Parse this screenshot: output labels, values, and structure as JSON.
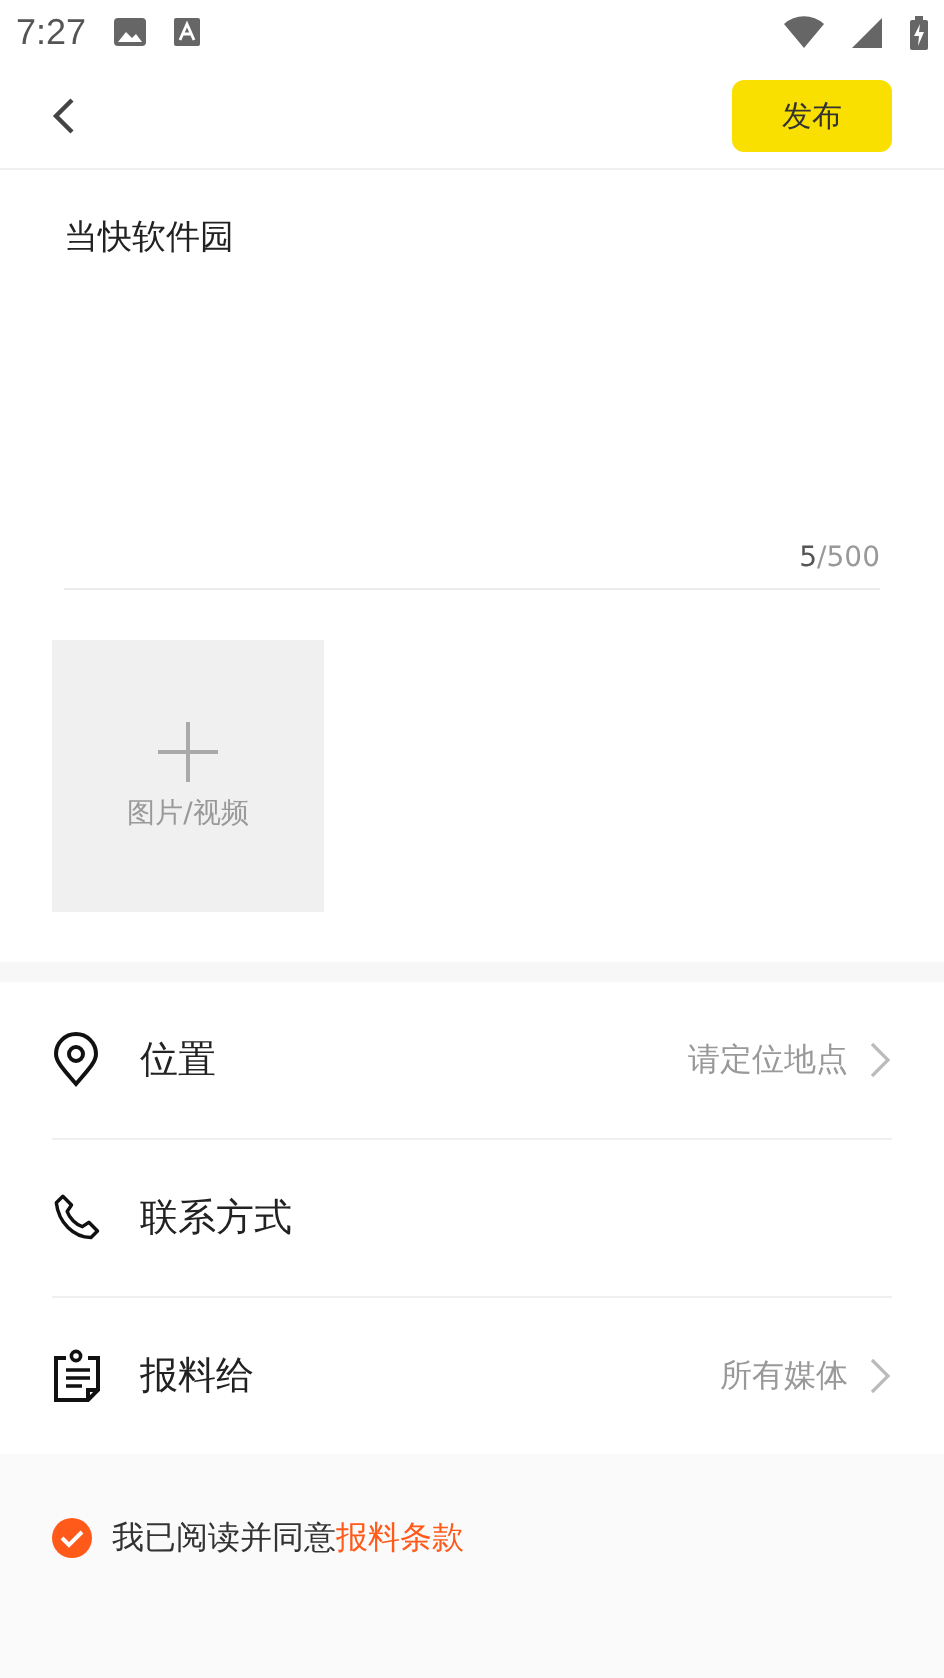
{
  "status_bar": {
    "time": "7:27"
  },
  "header": {
    "publish_button": "发布"
  },
  "editor": {
    "value": "当快软件园",
    "counter": {
      "current": "5",
      "max": "/500"
    }
  },
  "upload": {
    "label": "图片/视频"
  },
  "options": [
    {
      "kind": "location",
      "label": "位置",
      "value": "请定位地点",
      "chevron": true
    },
    {
      "kind": "phone",
      "label": "联系方式",
      "chevron": false
    },
    {
      "kind": "report",
      "label": "报料给",
      "value": "所有媒体",
      "chevron": true
    }
  ],
  "agreement": {
    "checked": true,
    "text": "我已阅读并同意",
    "link": "报料条款"
  }
}
